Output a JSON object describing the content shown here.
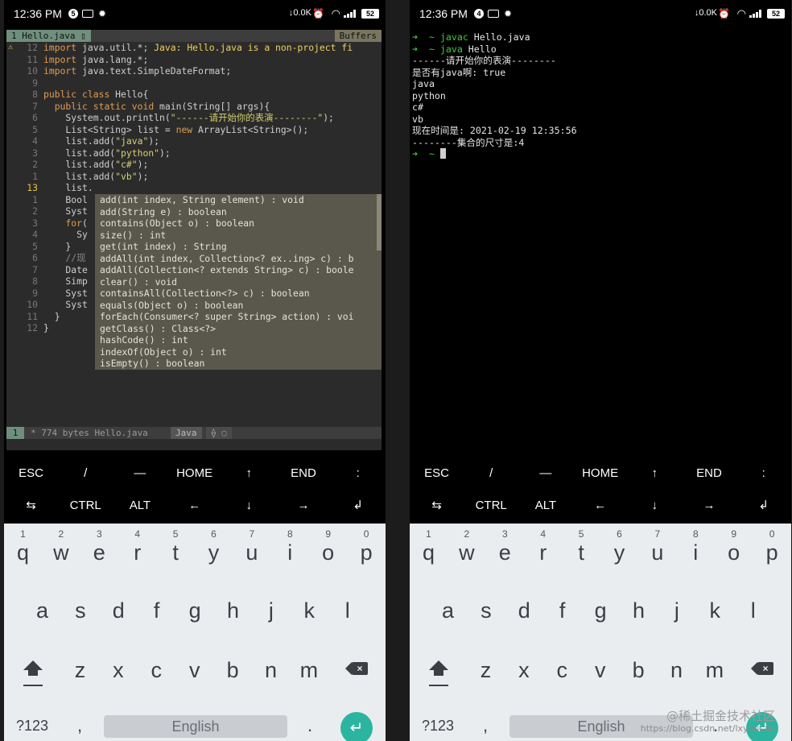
{
  "left_phone": {
    "status_bar": {
      "time": "12:36 PM",
      "notif_count": "5",
      "net_speed": "↓0.0K",
      "battery": "52"
    },
    "editor": {
      "tab_name": "1 Hello.java ▯",
      "buffers_label": "Buffers",
      "lines": [
        {
          "gutter": "⚠",
          "num": "12",
          "code": "import java.util.*; ",
          "warn": "Java: Hello.java is a non-project fi"
        },
        {
          "gutter": "",
          "num": "11",
          "code": "import java.lang.*;"
        },
        {
          "gutter": "",
          "num": "10",
          "code": "import java.text.SimpleDateFormat;"
        },
        {
          "gutter": "",
          "num": "9",
          "code": ""
        },
        {
          "gutter": "",
          "num": "8",
          "code": "public class Hello{"
        },
        {
          "gutter": "",
          "num": "7",
          "code": "  public static void main(String[] args){"
        },
        {
          "gutter": "",
          "num": "6",
          "code": "    System.out.println(\"------请开始你的表演--------\");"
        },
        {
          "gutter": "",
          "num": "5",
          "code": "    List<String> list = new ArrayList<String>();"
        },
        {
          "gutter": "",
          "num": "4",
          "code": "    list.add(\"java\");"
        },
        {
          "gutter": "",
          "num": "3",
          "code": "    list.add(\"python\");"
        },
        {
          "gutter": "",
          "num": "2",
          "code": "    list.add(\"c#\");"
        },
        {
          "gutter": "",
          "num": "1",
          "code": "    list.add(\"vb\");"
        },
        {
          "gutter": "",
          "num": "13",
          "code": "    list.",
          "current": true
        },
        {
          "gutter": "",
          "num": "1",
          "code": "    Bool"
        },
        {
          "gutter": "",
          "num": "2",
          "code": "    Syst"
        },
        {
          "gutter": "",
          "num": "3",
          "code": "    for("
        },
        {
          "gutter": "",
          "num": "4",
          "code": "      Sy"
        },
        {
          "gutter": "",
          "num": "5",
          "code": "    }"
        },
        {
          "gutter": "",
          "num": "6",
          "code": "    //现"
        },
        {
          "gutter": "",
          "num": "7",
          "code": "    Date"
        },
        {
          "gutter": "",
          "num": "8",
          "code": "    Simp"
        },
        {
          "gutter": "",
          "num": "9",
          "code": "    Syst"
        },
        {
          "gutter": "",
          "num": "10",
          "code": "    Syst"
        },
        {
          "gutter": "",
          "num": "11",
          "code": "  }"
        },
        {
          "gutter": "",
          "num": "12",
          "code": "}"
        }
      ],
      "completions": [
        "add(int index, String element) : void",
        "add(String e) : boolean",
        "contains(Object o) : boolean",
        "size() : int",
        "get(int index) : String",
        "addAll(int index, Collection<? ex..ing> c) : b",
        "addAll(Collection<? extends String> c) : boole",
        "clear() : void",
        "containsAll(Collection<?> c) : boolean",
        "equals(Object o) : boolean",
        "forEach(Consumer<? super String> action) : voi",
        "getClass() : Class<?>",
        "hashCode() : int",
        "indexOf(Object o) : int",
        "isEmpty() : boolean"
      ],
      "statusline": {
        "mode": "1",
        "file_info": "* 774 bytes Hello.java",
        "filetype": "Java",
        "extra": "⟠ ◌"
      }
    }
  },
  "right_phone": {
    "status_bar": {
      "time": "12:36 PM",
      "notif_count": "4",
      "net_speed": "↓0.0K",
      "battery": "52"
    },
    "terminal": {
      "lines": [
        {
          "prompt": "➜  ~ ",
          "cmd": "javac",
          "text": " Hello.java"
        },
        {
          "prompt": "➜  ~ ",
          "cmd": "java",
          "text": " Hello"
        },
        {
          "prompt": "",
          "cmd": "",
          "text": "------请开始你的表演--------"
        },
        {
          "prompt": "",
          "cmd": "",
          "text": "是否有java啊: true"
        },
        {
          "prompt": "",
          "cmd": "",
          "text": "java"
        },
        {
          "prompt": "",
          "cmd": "",
          "text": "python"
        },
        {
          "prompt": "",
          "cmd": "",
          "text": "c#"
        },
        {
          "prompt": "",
          "cmd": "",
          "text": "vb"
        },
        {
          "prompt": "",
          "cmd": "",
          "text": "现在时间是: 2021-02-19 12:35:56"
        },
        {
          "prompt": "",
          "cmd": "",
          "text": "--------集合的尺寸是:4"
        },
        {
          "prompt": "➜  ~ ",
          "cmd": "",
          "text": "",
          "cursor": true
        }
      ]
    }
  },
  "extra_keys": {
    "row1": [
      "ESC",
      "/",
      "—",
      "HOME",
      "↑",
      "END",
      ":"
    ],
    "row2": [
      "⇆",
      "CTRL",
      "ALT",
      "←",
      "↓",
      "→",
      "↲"
    ]
  },
  "keyboard": {
    "row1": [
      {
        "hint": "1",
        "ch": "q"
      },
      {
        "hint": "2",
        "ch": "w"
      },
      {
        "hint": "3",
        "ch": "e"
      },
      {
        "hint": "4",
        "ch": "r"
      },
      {
        "hint": "5",
        "ch": "t"
      },
      {
        "hint": "6",
        "ch": "y"
      },
      {
        "hint": "7",
        "ch": "u"
      },
      {
        "hint": "8",
        "ch": "i"
      },
      {
        "hint": "9",
        "ch": "o"
      },
      {
        "hint": "0",
        "ch": "p"
      }
    ],
    "row2": [
      "a",
      "s",
      "d",
      "f",
      "g",
      "h",
      "j",
      "k",
      "l"
    ],
    "row3": [
      "z",
      "x",
      "c",
      "v",
      "b",
      "n",
      "m"
    ],
    "sym_label": "?123",
    "comma": ",",
    "space_label": "English",
    "period": ".",
    "enter": "↵"
  },
  "watermark": {
    "title": "@稀土掘金技术社区",
    "url": "https://blog.csdn.net/lxyoucan"
  }
}
